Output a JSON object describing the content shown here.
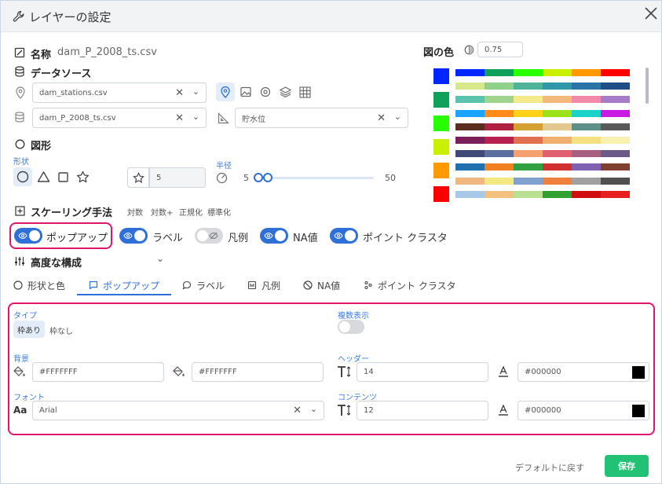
{
  "dialog": {
    "title": "レイヤーの設定"
  },
  "name": {
    "label": "名称",
    "value": "dam_P_2008_ts.csv"
  },
  "data_source": {
    "label": "データソース",
    "location_file": "dam_stations.csv",
    "data_file": "dam_P_2008_ts.csv",
    "value_field": "貯水位"
  },
  "shape": {
    "label": "図形",
    "shape_label": "形状",
    "size_value": "5",
    "radius_label": "半径",
    "radius_min": "5",
    "radius_max": "50"
  },
  "figure_color": {
    "label": "図の色",
    "opacity": "0.75",
    "selected_colors": [
      "#0026ff",
      "#0fa05a",
      "#28ff00",
      "#c8f000",
      "#ff9900",
      "#ff0000"
    ]
  },
  "palettes": [
    [
      "#0026ff",
      "#0fa05a",
      "#28ff00",
      "#c8f000",
      "#ff9900",
      "#ff0000"
    ],
    [
      "#d7e88a",
      "#8fd08a",
      "#4fb39a",
      "#2f97a8",
      "#2a74a8",
      "#1d4e86"
    ],
    [
      "#5bc3ad",
      "#9ed48c",
      "#f4ea8c",
      "#f4b87a",
      "#f08aa8",
      "#a67cc8"
    ],
    [
      "#1aa3ff",
      "#ff8c1a",
      "#ffd21a",
      "#9be21a",
      "#1ad2c8",
      "#c81ae2"
    ],
    [
      "#5a2d1e",
      "#b02040",
      "#d4a030",
      "#e3c890",
      "#5e9088",
      "#5a5a5a"
    ],
    [
      "#7a1f5a",
      "#b82050",
      "#e07050",
      "#f0b070",
      "#f4e080",
      "#f8f0b0"
    ],
    [
      "#404a78",
      "#5a6ea0",
      "#f4a070",
      "#e06070",
      "#a86080",
      "#6a5a8a"
    ],
    [
      "#2070b0",
      "#f08020",
      "#30a040",
      "#d03030",
      "#8060b0",
      "#804030"
    ],
    [
      "#f0b880",
      "#f4e880",
      "#80a0d0",
      "#f08040",
      "#a0a0a0",
      "#505050"
    ],
    [
      "#a8c8e8",
      "#f4c080",
      "#b8e090",
      "#30a030",
      "#d01010",
      "#e82020"
    ]
  ],
  "scaling": {
    "label": "スケーリング手法",
    "options": [
      "対数",
      "対数+",
      "正規化",
      "標準化"
    ]
  },
  "toggles": [
    {
      "label": "ポップアップ",
      "on": true
    },
    {
      "label": "ラベル",
      "on": true
    },
    {
      "label": "凡例",
      "on": false
    },
    {
      "label": "NA値",
      "on": true
    },
    {
      "label": "ポイント クラスタ",
      "on": true
    }
  ],
  "advanced": {
    "label": "高度な構成"
  },
  "tabs": [
    "形状と色",
    "ポップアップ",
    "ラベル",
    "凡例",
    "NA値",
    "ポイント クラスタ"
  ],
  "popup": {
    "type_label": "タイプ",
    "type_options": [
      "枠あり",
      "枠なし"
    ],
    "multi_label": "複数表示",
    "background_label": "背景",
    "bg_color1": "#FFFFFFF",
    "bg_color2": "#FFFFFFF",
    "header_label": "ヘッダー",
    "header_size": "14",
    "header_color": "#000000",
    "font_label": "フォント",
    "font_value": "Arial",
    "content_label": "コンテンツ",
    "content_size": "12",
    "content_color": "#000000"
  },
  "footer": {
    "reset": "デフォルトに戻す",
    "save": "保存"
  }
}
